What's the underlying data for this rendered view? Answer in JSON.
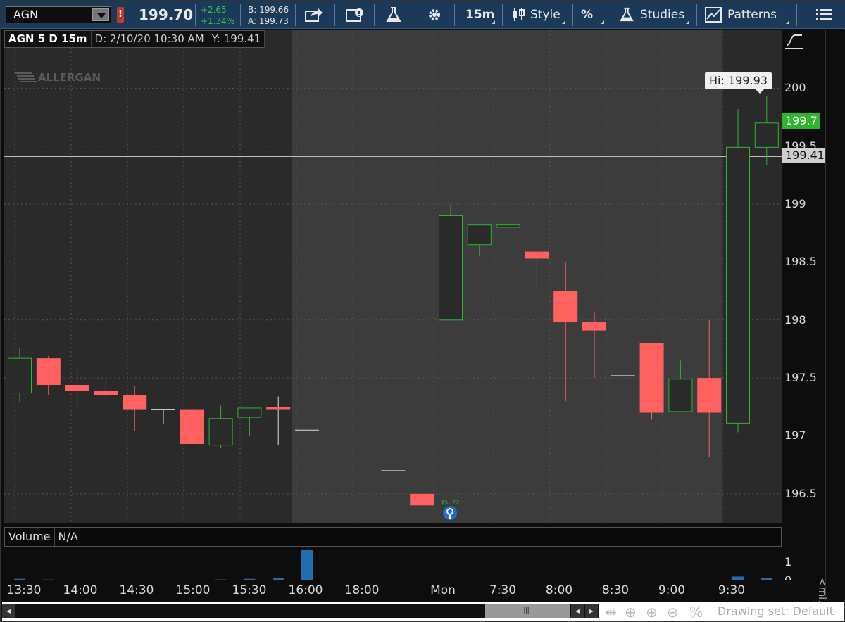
{
  "toolbar": {
    "symbol": "AGN",
    "last_price": "199.70",
    "change": "+2.65",
    "change_pct": "+1.34%",
    "bid": "B: 199.66",
    "ask": "A: 199.73",
    "interval": "15m",
    "style_label": "Style",
    "studies_label": "Studies",
    "patterns_label": "Patterns"
  },
  "infobar": {
    "title": "AGN 5 D 15m",
    "date": "D: 2/10/20 10:30 AM",
    "y": "Y: 199.41"
  },
  "watermark": "ALLERGAN",
  "hi_tooltip": "Hi: 199.93",
  "last_tag": "199.7",
  "cross_tag": "199.41",
  "y_ticks": [
    "200",
    "199.5",
    "199",
    "198.5",
    "198",
    "197.5",
    "197",
    "196.5"
  ],
  "x_ticks": [
    "13:30",
    "14:00",
    "14:30",
    "15:00",
    "15:30",
    "16:00",
    "18:00",
    "Mon",
    "7:30",
    "8:00",
    "8:30",
    "9:00",
    "9:30"
  ],
  "dividend_label": "$5.22",
  "volume_bar": {
    "label": "Volume",
    "value": "N/A"
  },
  "volume_axis": {
    "top": "1",
    "bottom": "0"
  },
  "drawing_set": "Drawing set: Default",
  "collapse_label": "<mi...",
  "colors": {
    "up": "#2db52d",
    "down": "#ff6060",
    "session_bg": "#2a2a2a",
    "extended_bg": "#3c3c3c",
    "volume": "#1f6fb0"
  },
  "chart_data": {
    "type": "candlestick",
    "ylim": [
      196.25,
      200.5
    ],
    "candles": [
      {
        "o": 197.37,
        "h": 197.76,
        "l": 197.29,
        "c": 197.67
      },
      {
        "o": 197.67,
        "h": 197.69,
        "l": 197.35,
        "c": 197.44
      },
      {
        "o": 197.44,
        "h": 197.59,
        "l": 197.24,
        "c": 197.39
      },
      {
        "o": 197.39,
        "h": 197.5,
        "l": 197.31,
        "c": 197.35
      },
      {
        "o": 197.35,
        "h": 197.43,
        "l": 197.04,
        "c": 197.23
      },
      {
        "o": 197.23,
        "h": 197.23,
        "l": 197.1,
        "c": 197.23
      },
      {
        "o": 197.23,
        "h": 197.23,
        "l": 196.93,
        "c": 196.93
      },
      {
        "o": 196.92,
        "h": 197.26,
        "l": 196.9,
        "c": 197.15
      },
      {
        "o": 197.16,
        "h": 197.24,
        "l": 197.0,
        "c": 197.24
      },
      {
        "o": 197.24,
        "h": 197.34,
        "l": 196.92,
        "c": 197.23
      },
      {
        "o": 197.05,
        "h": 197.05,
        "l": 197.05,
        "c": 197.05
      },
      {
        "o": 197.0,
        "h": 197.0,
        "l": 197.0,
        "c": 197.0
      },
      {
        "o": 197.0,
        "h": 197.0,
        "l": 197.0,
        "c": 197.0
      },
      {
        "o": 196.7,
        "h": 196.7,
        "l": 196.7,
        "c": 196.7
      },
      {
        "o": 196.5,
        "h": 196.5,
        "l": 196.4,
        "c": 196.4
      },
      {
        "o": 198.0,
        "h": 199.0,
        "l": 198.0,
        "c": 198.9
      },
      {
        "o": 198.65,
        "h": 198.82,
        "l": 198.55,
        "c": 198.82
      },
      {
        "o": 198.8,
        "h": 198.82,
        "l": 198.75,
        "c": 198.82
      },
      {
        "o": 198.59,
        "h": 198.59,
        "l": 198.25,
        "c": 198.53
      },
      {
        "o": 198.25,
        "h": 198.5,
        "l": 197.3,
        "c": 197.98
      },
      {
        "o": 197.98,
        "h": 198.07,
        "l": 197.5,
        "c": 197.91
      },
      {
        "o": 197.52,
        "h": 197.52,
        "l": 197.52,
        "c": 197.52
      },
      {
        "o": 197.8,
        "h": 197.8,
        "l": 197.14,
        "c": 197.2
      },
      {
        "o": 197.21,
        "h": 197.65,
        "l": 197.21,
        "c": 197.49
      },
      {
        "o": 197.5,
        "h": 198.0,
        "l": 196.82,
        "c": 197.2
      },
      {
        "o": 197.11,
        "h": 199.82,
        "l": 197.03,
        "c": 199.49
      },
      {
        "o": 199.49,
        "h": 199.93,
        "l": 199.34,
        "c": 199.7
      }
    ],
    "volume": [
      0.05,
      0.03,
      0,
      0,
      0,
      0,
      0,
      0.03,
      0.05,
      0.07,
      0.95,
      0,
      0,
      0,
      0,
      0,
      0,
      0,
      0,
      0,
      0,
      0,
      0,
      0,
      0,
      0.12,
      0.08
    ],
    "crosshair_y": 199.41
  }
}
